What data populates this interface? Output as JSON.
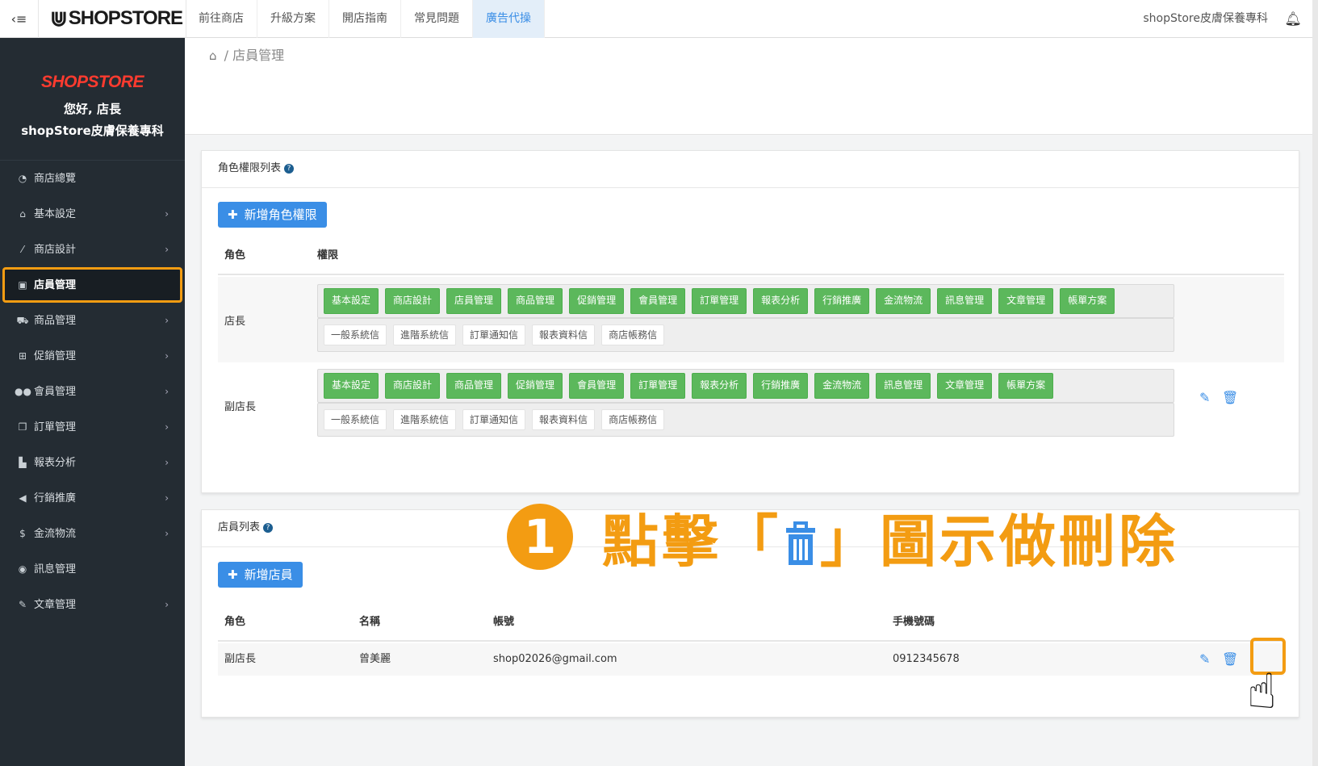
{
  "topbar": {
    "logo": "SHOPSTORE",
    "nav": [
      "前往商店",
      "升級方案",
      "開店指南",
      "常見問題",
      "廣告代操"
    ],
    "active_nav": "廣告代操",
    "store_name": "shopStore皮膚保養專科"
  },
  "sidebar": {
    "logo": "SHOPSTORE",
    "greeting": "您好, 店長",
    "store_name": "shopStore皮膚保養專科",
    "items": [
      {
        "label": "商店總覽",
        "icon": "dashboard-icon",
        "has_arrow": false
      },
      {
        "label": "基本設定",
        "icon": "bank-icon",
        "has_arrow": true
      },
      {
        "label": "商店設計",
        "icon": "magic-wand-icon",
        "has_arrow": true
      },
      {
        "label": "店員管理",
        "icon": "lock-icon",
        "has_arrow": false,
        "active": true
      },
      {
        "label": "商品管理",
        "icon": "cart-icon",
        "has_arrow": true
      },
      {
        "label": "促銷管理",
        "icon": "gift-icon",
        "has_arrow": true
      },
      {
        "label": "會員管理",
        "icon": "users-icon",
        "has_arrow": true
      },
      {
        "label": "訂單管理",
        "icon": "copy-icon",
        "has_arrow": true
      },
      {
        "label": "報表分析",
        "icon": "bar-chart-icon",
        "has_arrow": true
      },
      {
        "label": "行銷推廣",
        "icon": "bullhorn-icon",
        "has_arrow": true
      },
      {
        "label": "金流物流",
        "icon": "dollar-icon",
        "has_arrow": true
      },
      {
        "label": "訊息管理",
        "icon": "comments-icon",
        "has_arrow": false
      },
      {
        "label": "文章管理",
        "icon": "edit-icon",
        "has_arrow": true
      }
    ]
  },
  "breadcrumb": {
    "separator": "/",
    "current": "店員管理"
  },
  "roles_panel": {
    "title": "角色權限列表",
    "add_button": "新增角色權限",
    "col_role": "角色",
    "col_perm": "權限",
    "rows": [
      {
        "role": "店長",
        "modules": [
          "基本設定",
          "商店設計",
          "店員管理",
          "商品管理",
          "促銷管理",
          "會員管理",
          "訂單管理",
          "報表分析",
          "行銷推廣",
          "金流物流",
          "訊息管理",
          "文章管理",
          "帳單方案"
        ],
        "mails": [
          "一般系統信",
          "進階系統信",
          "訂單通知信",
          "報表資料信",
          "商店帳務信"
        ]
      },
      {
        "role": "副店長",
        "modules": [
          "基本設定",
          "商店設計",
          "商品管理",
          "促銷管理",
          "會員管理",
          "訂單管理",
          "報表分析",
          "行銷推廣",
          "金流物流",
          "訊息管理",
          "文章管理",
          "帳單方案"
        ],
        "mails": [
          "一般系統信",
          "進階系統信",
          "訂單通知信",
          "報表資料信",
          "商店帳務信"
        ]
      }
    ]
  },
  "staff_panel": {
    "title": "店員列表",
    "add_button": "新增店員",
    "cols": [
      "角色",
      "名稱",
      "帳號",
      "手機號碼"
    ],
    "rows": [
      {
        "role": "副店長",
        "name": "曾美麗",
        "account": "shop02026@gmail.com",
        "phone": "0912345678"
      }
    ]
  },
  "annotation": {
    "number": "1",
    "text_before": "點擊「",
    "text_after": "」圖示做刪除",
    "color": "#f39c12"
  },
  "colors": {
    "accent": "#3a8ee6",
    "perm_green": "#5cb85c",
    "sidebar_bg": "#242c33",
    "highlight": "#f39c12"
  }
}
